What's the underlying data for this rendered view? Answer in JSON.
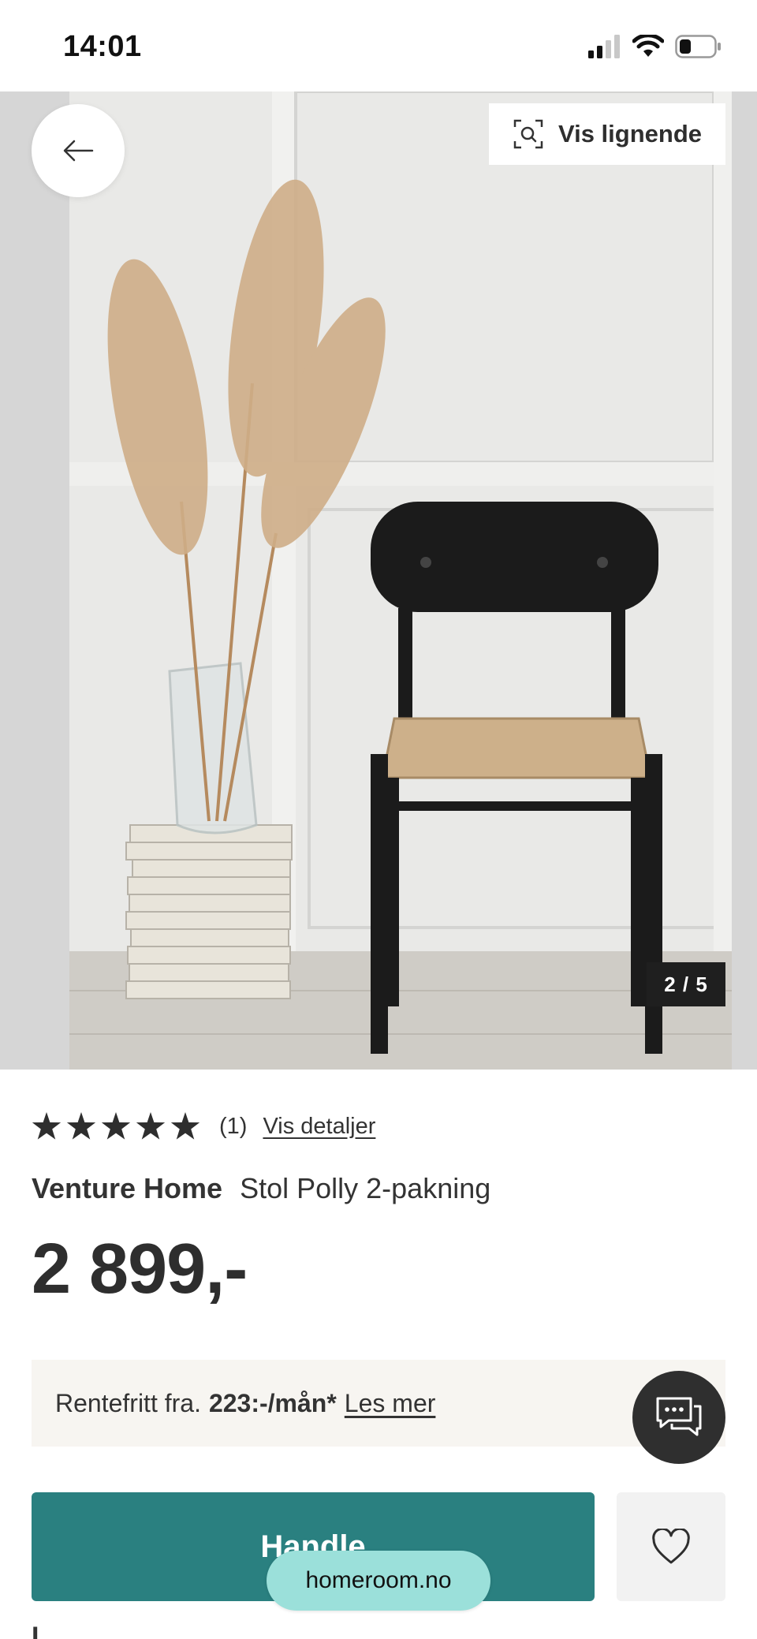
{
  "status_bar": {
    "time": "14:01"
  },
  "product_image": {
    "description_icon": "chair-photo",
    "counter": "2 / 5"
  },
  "header_actions": {
    "similar_label": "Vis lignende"
  },
  "rating": {
    "stars": 5,
    "count": "(1)",
    "details_label": "Vis detaljer"
  },
  "product": {
    "brand": "Venture Home",
    "name": "Stol Polly 2-pakning",
    "price": "2 899,-"
  },
  "financing": {
    "prefix": "Rentefritt fra.",
    "amount": "223:-/mån*",
    "link_label": "Les mer"
  },
  "actions": {
    "buy_label": "Handle",
    "wishlist_icon": "heart-icon",
    "chat_icon": "chat-bubble-icon"
  },
  "browser": {
    "domain": "homeroom.no"
  },
  "footer_partial": "I",
  "colors": {
    "primary": "#2a8080",
    "domain_pill": "#9be0da",
    "finance_bg": "#f7f5f1"
  }
}
